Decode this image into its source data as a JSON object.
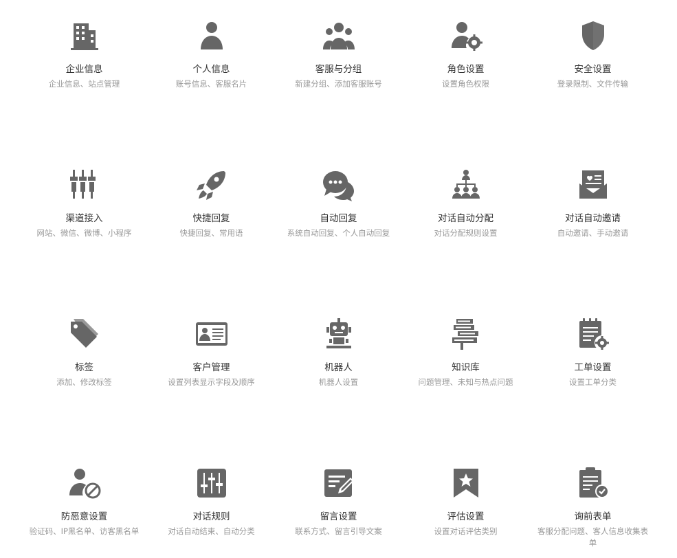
{
  "colors": {
    "icon": "#666666",
    "title": "#333333",
    "desc": "#999999"
  },
  "items": [
    {
      "title": "企业信息",
      "desc": "企业信息、站点管理",
      "icon": "building-icon"
    },
    {
      "title": "个人信息",
      "desc": "账号信息、客服名片",
      "icon": "person-icon"
    },
    {
      "title": "客服与分组",
      "desc": "新建分组、添加客服账号",
      "icon": "group-icon"
    },
    {
      "title": "角色设置",
      "desc": "设置角色权限",
      "icon": "user-gear-icon"
    },
    {
      "title": "安全设置",
      "desc": "登录限制、文件传输",
      "icon": "shield-icon"
    },
    {
      "title": "渠道接入",
      "desc": "网站、微信、微博、小程序",
      "icon": "plugs-icon"
    },
    {
      "title": "快捷回复",
      "desc": "快捷回复、常用语",
      "icon": "rocket-icon"
    },
    {
      "title": "自动回复",
      "desc": "系统自动回复、个人自动回复",
      "icon": "chat-bubbles-icon"
    },
    {
      "title": "对话自动分配",
      "desc": "对话分配规则设置",
      "icon": "hierarchy-icon"
    },
    {
      "title": "对话自动邀请",
      "desc": "自动邀请、手动邀请",
      "icon": "invitation-icon"
    },
    {
      "title": "标签",
      "desc": "添加、修改标签",
      "icon": "tag-icon"
    },
    {
      "title": "客户管理",
      "desc": "设置列表显示字段及顺序",
      "icon": "id-card-icon"
    },
    {
      "title": "机器人",
      "desc": "机器人设置",
      "icon": "robot-icon"
    },
    {
      "title": "知识库",
      "desc": "问题管理、未知与热点问题",
      "icon": "books-icon"
    },
    {
      "title": "工单设置",
      "desc": "设置工单分类",
      "icon": "notepad-gear-icon"
    },
    {
      "title": "防恶意设置",
      "desc": "验证码、IP黑名单、访客黑名单",
      "icon": "user-block-icon"
    },
    {
      "title": "对话规则",
      "desc": "对话自动结束、自动分类",
      "icon": "sliders-icon"
    },
    {
      "title": "留言设置",
      "desc": "联系方式、留言引导文案",
      "icon": "edit-note-icon"
    },
    {
      "title": "评估设置",
      "desc": "设置对话评估类别",
      "icon": "star-bookmark-icon"
    },
    {
      "title": "询前表单",
      "desc": "客服分配问题、客人信息收集表单",
      "icon": "clipboard-check-icon"
    }
  ]
}
